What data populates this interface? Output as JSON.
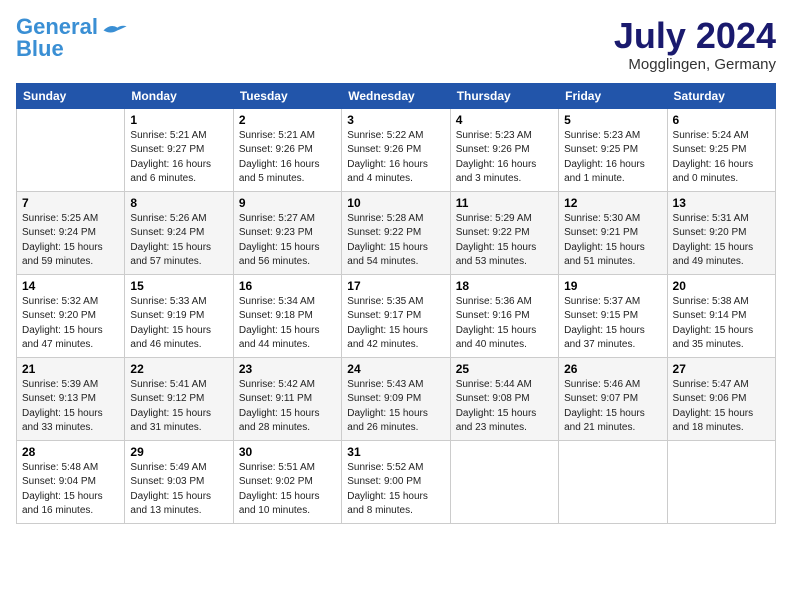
{
  "logo": {
    "line1": "General",
    "line2": "Blue"
  },
  "title": "July 2024",
  "location": "Mogglingen, Germany",
  "weekdays": [
    "Sunday",
    "Monday",
    "Tuesday",
    "Wednesday",
    "Thursday",
    "Friday",
    "Saturday"
  ],
  "weeks": [
    [
      {
        "day": "",
        "content": ""
      },
      {
        "day": "1",
        "content": "Sunrise: 5:21 AM\nSunset: 9:27 PM\nDaylight: 16 hours\nand 6 minutes."
      },
      {
        "day": "2",
        "content": "Sunrise: 5:21 AM\nSunset: 9:26 PM\nDaylight: 16 hours\nand 5 minutes."
      },
      {
        "day": "3",
        "content": "Sunrise: 5:22 AM\nSunset: 9:26 PM\nDaylight: 16 hours\nand 4 minutes."
      },
      {
        "day": "4",
        "content": "Sunrise: 5:23 AM\nSunset: 9:26 PM\nDaylight: 16 hours\nand 3 minutes."
      },
      {
        "day": "5",
        "content": "Sunrise: 5:23 AM\nSunset: 9:25 PM\nDaylight: 16 hours\nand 1 minute."
      },
      {
        "day": "6",
        "content": "Sunrise: 5:24 AM\nSunset: 9:25 PM\nDaylight: 16 hours\nand 0 minutes."
      }
    ],
    [
      {
        "day": "7",
        "content": "Sunrise: 5:25 AM\nSunset: 9:24 PM\nDaylight: 15 hours\nand 59 minutes."
      },
      {
        "day": "8",
        "content": "Sunrise: 5:26 AM\nSunset: 9:24 PM\nDaylight: 15 hours\nand 57 minutes."
      },
      {
        "day": "9",
        "content": "Sunrise: 5:27 AM\nSunset: 9:23 PM\nDaylight: 15 hours\nand 56 minutes."
      },
      {
        "day": "10",
        "content": "Sunrise: 5:28 AM\nSunset: 9:22 PM\nDaylight: 15 hours\nand 54 minutes."
      },
      {
        "day": "11",
        "content": "Sunrise: 5:29 AM\nSunset: 9:22 PM\nDaylight: 15 hours\nand 53 minutes."
      },
      {
        "day": "12",
        "content": "Sunrise: 5:30 AM\nSunset: 9:21 PM\nDaylight: 15 hours\nand 51 minutes."
      },
      {
        "day": "13",
        "content": "Sunrise: 5:31 AM\nSunset: 9:20 PM\nDaylight: 15 hours\nand 49 minutes."
      }
    ],
    [
      {
        "day": "14",
        "content": "Sunrise: 5:32 AM\nSunset: 9:20 PM\nDaylight: 15 hours\nand 47 minutes."
      },
      {
        "day": "15",
        "content": "Sunrise: 5:33 AM\nSunset: 9:19 PM\nDaylight: 15 hours\nand 46 minutes."
      },
      {
        "day": "16",
        "content": "Sunrise: 5:34 AM\nSunset: 9:18 PM\nDaylight: 15 hours\nand 44 minutes."
      },
      {
        "day": "17",
        "content": "Sunrise: 5:35 AM\nSunset: 9:17 PM\nDaylight: 15 hours\nand 42 minutes."
      },
      {
        "day": "18",
        "content": "Sunrise: 5:36 AM\nSunset: 9:16 PM\nDaylight: 15 hours\nand 40 minutes."
      },
      {
        "day": "19",
        "content": "Sunrise: 5:37 AM\nSunset: 9:15 PM\nDaylight: 15 hours\nand 37 minutes."
      },
      {
        "day": "20",
        "content": "Sunrise: 5:38 AM\nSunset: 9:14 PM\nDaylight: 15 hours\nand 35 minutes."
      }
    ],
    [
      {
        "day": "21",
        "content": "Sunrise: 5:39 AM\nSunset: 9:13 PM\nDaylight: 15 hours\nand 33 minutes."
      },
      {
        "day": "22",
        "content": "Sunrise: 5:41 AM\nSunset: 9:12 PM\nDaylight: 15 hours\nand 31 minutes."
      },
      {
        "day": "23",
        "content": "Sunrise: 5:42 AM\nSunset: 9:11 PM\nDaylight: 15 hours\nand 28 minutes."
      },
      {
        "day": "24",
        "content": "Sunrise: 5:43 AM\nSunset: 9:09 PM\nDaylight: 15 hours\nand 26 minutes."
      },
      {
        "day": "25",
        "content": "Sunrise: 5:44 AM\nSunset: 9:08 PM\nDaylight: 15 hours\nand 23 minutes."
      },
      {
        "day": "26",
        "content": "Sunrise: 5:46 AM\nSunset: 9:07 PM\nDaylight: 15 hours\nand 21 minutes."
      },
      {
        "day": "27",
        "content": "Sunrise: 5:47 AM\nSunset: 9:06 PM\nDaylight: 15 hours\nand 18 minutes."
      }
    ],
    [
      {
        "day": "28",
        "content": "Sunrise: 5:48 AM\nSunset: 9:04 PM\nDaylight: 15 hours\nand 16 minutes."
      },
      {
        "day": "29",
        "content": "Sunrise: 5:49 AM\nSunset: 9:03 PM\nDaylight: 15 hours\nand 13 minutes."
      },
      {
        "day": "30",
        "content": "Sunrise: 5:51 AM\nSunset: 9:02 PM\nDaylight: 15 hours\nand 10 minutes."
      },
      {
        "day": "31",
        "content": "Sunrise: 5:52 AM\nSunset: 9:00 PM\nDaylight: 15 hours\nand 8 minutes."
      },
      {
        "day": "",
        "content": ""
      },
      {
        "day": "",
        "content": ""
      },
      {
        "day": "",
        "content": ""
      }
    ]
  ]
}
